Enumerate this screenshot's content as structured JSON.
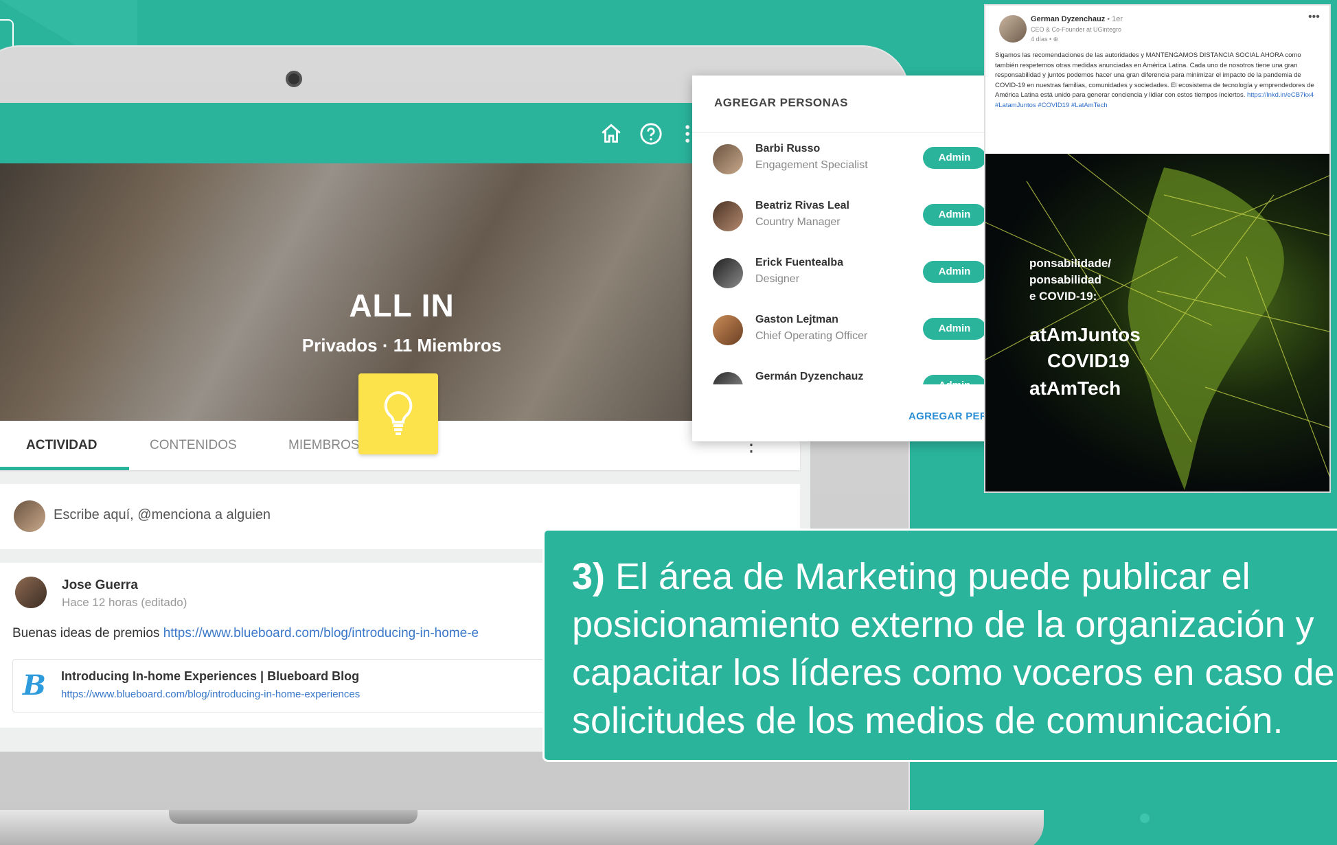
{
  "app": {
    "hero": {
      "title": "ALL IN",
      "subtitle": "Privados · 11 Miembros"
    },
    "tabs": [
      {
        "label": "ACTIVIDAD",
        "active": true
      },
      {
        "label": "CONTENIDOS",
        "active": false
      },
      {
        "label": "MIEMBROS",
        "active": false
      }
    ],
    "composer": {
      "placeholder": "Escribe aquí, @menciona a alguien"
    },
    "post": {
      "author": "Jose Guerra",
      "time": "Hace 12 horas (editado)",
      "body_prefix": "Buenas ideas de premios ",
      "body_link": "https://www.blueboard.com/blog/introducing-in-home-e",
      "link_card": {
        "logo": "B",
        "title": "Introducing In-home Experiences | Blueboard Blog",
        "url": "https://www.blueboard.com/blog/introducing-in-home-experiences"
      }
    },
    "header_icons": [
      "home-icon",
      "help-icon",
      "apps-grid-icon"
    ],
    "accent_color": "#2ab49c"
  },
  "popup": {
    "title": "AGREGAR PERSONAS",
    "action": "AGREGAR PERSONA",
    "people": [
      {
        "name": "Barbi Russo",
        "role": "Engagement Specialist",
        "badge": "Admin"
      },
      {
        "name": "Beatriz Rivas Leal",
        "role": "Country Manager",
        "badge": "Admin"
      },
      {
        "name": "Erick Fuentealba",
        "role": "Designer",
        "badge": "Admin"
      },
      {
        "name": "Gaston Lejtman",
        "role": "Chief Operating Officer",
        "badge": "Admin"
      },
      {
        "name": "Germán Dyzenchauz",
        "role": "",
        "badge": "Admin"
      }
    ]
  },
  "linkedin": {
    "name": "German Dyzenchauz",
    "degree": " • 1er",
    "headline": "CEO & Co-Founder at UGintegro",
    "time": "4 días • ⊕",
    "text": "Sigamos las recomendaciones de las autoridades y MANTENGAMOS DISTANCIA SOCIAL AHORA como también respetemos otras medidas anunciadas en América Latina. Cada uno de nosotros tiene una gran responsabilidad y juntos podemos hacer una gran diferencia para minimizar el impacto de la pandemia de COVID-19 en nuestras familias, comunidades y sociedades. El ecosistema de tecnología y emprendedores de América Latina está unido para generar conciencia y lidiar con estos tiempos inciertos.",
    "text_link": "https://lnkd.in/eCB7kx4 #LatamJuntos #COVID19 #LatAmTech",
    "image_lines": [
      "ponsabilidade/",
      "ponsabilidad",
      "e COVID-19:",
      "atAmJuntos",
      "COVID19",
      "atAmTech"
    ]
  },
  "caption": {
    "number": "3)",
    "text": "El área de Marketing puede publicar el posicionamiento externo de la organización y capacitar los líderes como voceros en caso de solicitudes de los medios de comunicación.",
    "line1": "El área de Marketing puede publicar el",
    "line2": "posicionamiento externo de la organización y",
    "line3": "capacitar los líderes como voceros en caso de",
    "line4": "solicitudes de los medios de comunicación."
  }
}
